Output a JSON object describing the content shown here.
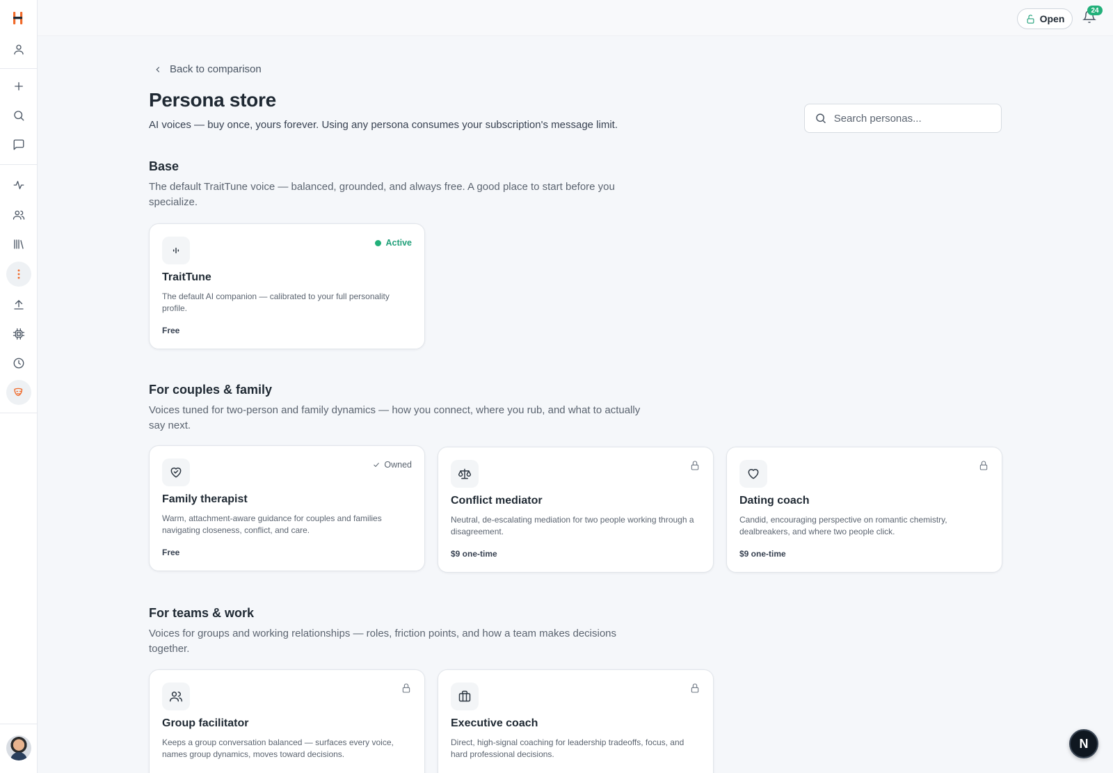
{
  "topbar": {
    "open_label": "Open",
    "notifications_count": "24"
  },
  "sidebar": {
    "icons": [
      "logo",
      "profile-icon",
      "plus-icon",
      "search-icon",
      "chat-icon",
      "sparkle-icon",
      "people-icon",
      "library-icon",
      "more-vertical-icon",
      "upload-icon",
      "chip-icon",
      "clock-icon",
      "persona-mask-icon"
    ],
    "accent_color": "#f06a2a"
  },
  "header": {
    "back_label": "Back to comparison",
    "title": "Persona store",
    "subtitle": "AI voices — buy once, yours forever. Using any persona consumes your subscription's message limit.",
    "search_placeholder": "Search personas..."
  },
  "sections": [
    {
      "title": "Base",
      "description": "The default TraitTune voice — balanced, grounded, and always free. A good place to start before you specialize.",
      "cards": [
        {
          "title": "TraitTune",
          "description": "The default AI companion — calibrated to your full personality profile.",
          "price": "Free",
          "status": "Active",
          "icon": "waveform-icon"
        }
      ]
    },
    {
      "title": "For couples & family",
      "description": "Voices tuned for two-person and family dynamics — how you connect, where you rub, and what to actually say next.",
      "cards": [
        {
          "title": "Family therapist",
          "description": "Warm, attachment-aware guidance for couples and families navigating closeness, conflict, and care.",
          "price": "Free",
          "status": "Owned",
          "icon": "heart-handshake-icon"
        },
        {
          "title": "Conflict mediator",
          "description": "Neutral, de-escalating mediation for two people working through a disagreement.",
          "price": "$9 one-time",
          "status": "locked",
          "icon": "scale-icon"
        },
        {
          "title": "Dating coach",
          "description": "Candid, encouraging perspective on romantic chemistry, dealbreakers, and where two people click.",
          "price": "$9 one-time",
          "status": "locked",
          "icon": "heart-icon"
        }
      ]
    },
    {
      "title": "For teams & work",
      "description": "Voices for groups and working relationships — roles, friction points, and how a team makes decisions together.",
      "cards": [
        {
          "title": "Group facilitator",
          "description": "Keeps a group conversation balanced — surfaces every voice, names group dynamics, moves toward decisions.",
          "status": "locked",
          "icon": "users-icon"
        },
        {
          "title": "Executive coach",
          "description": "Direct, high-signal coaching for leadership tradeoffs, focus, and hard professional decisions.",
          "status": "locked",
          "icon": "briefcase-icon"
        }
      ]
    }
  ],
  "fab_label": "N"
}
